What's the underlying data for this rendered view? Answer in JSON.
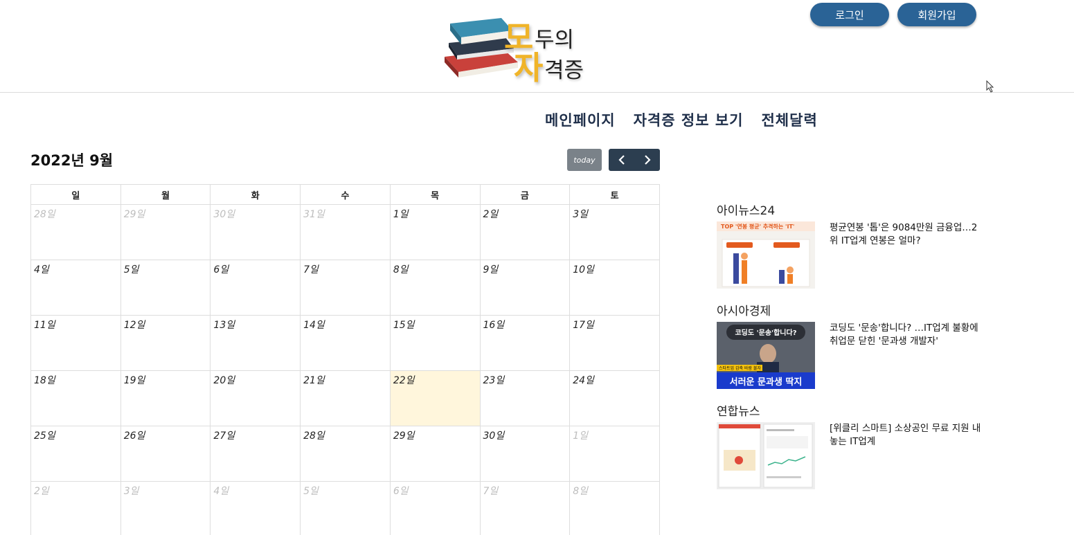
{
  "header": {
    "logo": {
      "big1": "모",
      "small1": "두의",
      "big2": "자",
      "small2": "격증"
    },
    "login_label": "로그인",
    "signup_label": "회원가입"
  },
  "nav": {
    "items": [
      {
        "label": "메인페이지"
      },
      {
        "label": "자격증 정보 보기"
      },
      {
        "label": "전체달력"
      }
    ]
  },
  "calendar": {
    "title": "2022년 9월",
    "today_label": "today",
    "prev_icon": "chevron-left-icon",
    "next_icon": "chevron-right-icon",
    "weekdays": [
      "일",
      "월",
      "화",
      "수",
      "목",
      "금",
      "토"
    ],
    "weeks": [
      [
        {
          "d": "28일",
          "o": true
        },
        {
          "d": "29일",
          "o": true
        },
        {
          "d": "30일",
          "o": true
        },
        {
          "d": "31일",
          "o": true
        },
        {
          "d": "1일"
        },
        {
          "d": "2일"
        },
        {
          "d": "3일"
        }
      ],
      [
        {
          "d": "4일"
        },
        {
          "d": "5일"
        },
        {
          "d": "6일"
        },
        {
          "d": "7일"
        },
        {
          "d": "8일"
        },
        {
          "d": "9일"
        },
        {
          "d": "10일"
        }
      ],
      [
        {
          "d": "11일"
        },
        {
          "d": "12일"
        },
        {
          "d": "13일"
        },
        {
          "d": "14일"
        },
        {
          "d": "15일"
        },
        {
          "d": "16일"
        },
        {
          "d": "17일"
        }
      ],
      [
        {
          "d": "18일"
        },
        {
          "d": "19일"
        },
        {
          "d": "20일"
        },
        {
          "d": "21일"
        },
        {
          "d": "22일",
          "t": true
        },
        {
          "d": "23일"
        },
        {
          "d": "24일"
        }
      ],
      [
        {
          "d": "25일"
        },
        {
          "d": "26일"
        },
        {
          "d": "27일"
        },
        {
          "d": "28일"
        },
        {
          "d": "29일"
        },
        {
          "d": "30일"
        },
        {
          "d": "1일",
          "o": true
        }
      ],
      [
        {
          "d": "2일",
          "o": true
        },
        {
          "d": "3일",
          "o": true
        },
        {
          "d": "4일",
          "o": true
        },
        {
          "d": "5일",
          "o": true
        },
        {
          "d": "6일",
          "o": true
        },
        {
          "d": "7일",
          "o": true
        },
        {
          "d": "8일",
          "o": true
        }
      ]
    ],
    "today_highlight_color": "#fff6dc"
  },
  "news": [
    {
      "source": "아이뉴스24",
      "headline": "평균연봉 '톱'은 9084만원 금융업…2위 IT업계 연봉은 얼마?",
      "thumb_text": "TOP '연봉 평균' 추격하는 'IT'"
    },
    {
      "source": "아시아경제",
      "headline": "코딩도 '문송'합니다? …IT업계 불황에 취업문 닫힌 '문과생 개발자'",
      "thumb_text_top": "코딩도 '문송'합니다?",
      "thumb_text_tag": "스타트업 감축 바람 불자",
      "thumb_text_bottom": "서러운 문과생 딱지"
    },
    {
      "source": "연합뉴스",
      "headline": "[위클리 스마트] 소상공인 무료 지원 내놓는 IT업계"
    }
  ],
  "colors": {
    "primary_button": "#2a6396",
    "nav_text": "#1f2f4a",
    "arrow_group": "#2c3e50",
    "today_button": "#6c757d",
    "logo_accent": "#f0b429"
  }
}
